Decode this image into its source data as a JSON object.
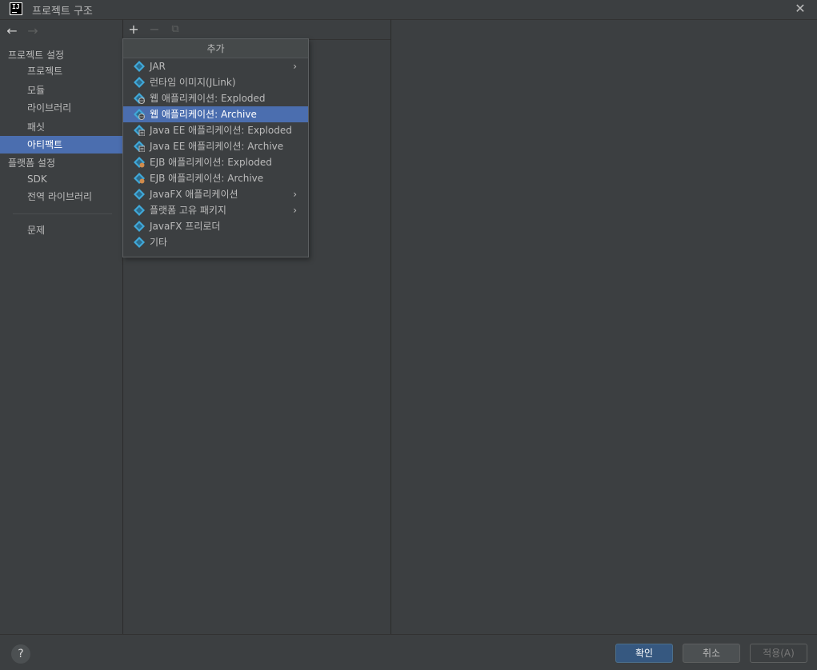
{
  "window": {
    "title": "프로젝트 구조",
    "logo_text": "IJ",
    "close_glyph": "✕"
  },
  "nav": {
    "back_glyph": "←",
    "forward_glyph": "→"
  },
  "sidebar": {
    "project_settings_header": "프로젝트 설정",
    "project_items": [
      "프로젝트",
      "모듈",
      "라이브러리",
      "패싯",
      "아티팩트"
    ],
    "selected_item": "아티팩트",
    "platform_settings_header": "플랫폼 설정",
    "platform_items": [
      "SDK",
      "전역 라이브러리"
    ],
    "problems": "문제"
  },
  "toolbar": {
    "add_glyph": "+",
    "remove_glyph": "−",
    "copy_glyph": "⧉"
  },
  "popup": {
    "header": "추가",
    "items": [
      {
        "label": "JAR",
        "icon": "artifact-icon",
        "has_submenu": true
      },
      {
        "label": "런타임 이미지(JLink)",
        "icon": "artifact-icon",
        "has_submenu": false
      },
      {
        "label": "웹 애플리케이션: Exploded",
        "icon": "web-artifact-icon",
        "has_submenu": false
      },
      {
        "label": "웹 애플리케이션: Archive",
        "icon": "web-artifact-icon",
        "has_submenu": false,
        "selected": true
      },
      {
        "label": "Java EE 애플리케이션: Exploded",
        "icon": "javaee-artifact-icon",
        "has_submenu": false
      },
      {
        "label": "Java EE 애플리케이션: Archive",
        "icon": "javaee-artifact-icon",
        "has_submenu": false
      },
      {
        "label": "EJB 애플리케이션: Exploded",
        "icon": "ejb-artifact-icon",
        "has_submenu": false
      },
      {
        "label": "EJB 애플리케이션: Archive",
        "icon": "ejb-artifact-icon",
        "has_submenu": false
      },
      {
        "label": "JavaFX 애플리케이션",
        "icon": "artifact-icon",
        "has_submenu": true
      },
      {
        "label": "플랫폼 고유 패키지",
        "icon": "artifact-icon",
        "has_submenu": true
      },
      {
        "label": "JavaFX 프리로더",
        "icon": "artifact-icon",
        "has_submenu": false
      },
      {
        "label": "기타",
        "icon": "artifact-icon",
        "has_submenu": false
      }
    ]
  },
  "footer": {
    "help_glyph": "?",
    "ok_label": "확인",
    "cancel_label": "취소",
    "apply_label": "적용(A)"
  },
  "colors": {
    "background": "#3c3f41",
    "selection": "#4b6eaf",
    "primary_button": "#365880",
    "artifact_icon": "#40a8d8"
  }
}
